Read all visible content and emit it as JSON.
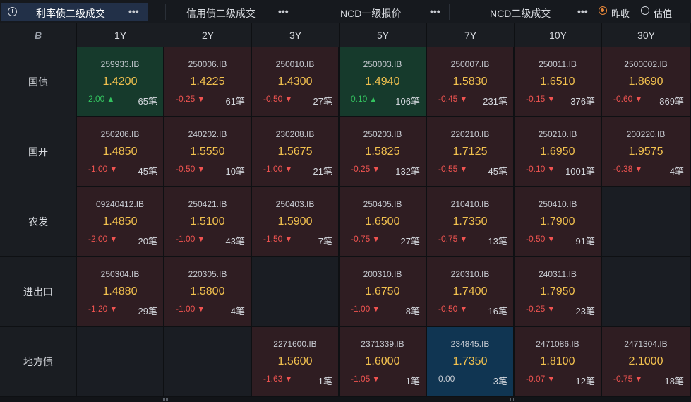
{
  "tabs": [
    {
      "label": "利率债二级成交",
      "more": "•••",
      "active": true
    },
    {
      "label": "信用债二级成交",
      "more": "•••",
      "active": false
    },
    {
      "label": "NCD一级报价",
      "more": "•••",
      "active": false
    },
    {
      "label": "NCD二级成交",
      "more": "•••",
      "active": false
    }
  ],
  "radios": [
    {
      "label": "昨收",
      "checked": true
    },
    {
      "label": "估值",
      "checked": false
    }
  ],
  "tenors": [
    "1Y",
    "2Y",
    "3Y",
    "5Y",
    "7Y",
    "10Y",
    "30Y"
  ],
  "corner_icon": "bloomberg-b-icon",
  "colors": {
    "down": "#ef5350",
    "up": "#33c25f",
    "yield": "#f2c14e",
    "active_tab": "#223048",
    "radio_checked": "#e7873a"
  },
  "rows": [
    {
      "name": "国债",
      "cells": [
        {
          "code": "259933.IB",
          "yield": "1.4200",
          "change": "2.00",
          "dir": "up",
          "count": "65笔"
        },
        {
          "code": "250006.IB",
          "yield": "1.4225",
          "change": "-0.25",
          "dir": "down",
          "count": "61笔"
        },
        {
          "code": "250010.IB",
          "yield": "1.4300",
          "change": "-0.50",
          "dir": "down",
          "count": "27笔"
        },
        {
          "code": "250003.IB",
          "yield": "1.4940",
          "change": "0.10",
          "dir": "up",
          "count": "106笔"
        },
        {
          "code": "250007.IB",
          "yield": "1.5830",
          "change": "-0.45",
          "dir": "down",
          "count": "231笔"
        },
        {
          "code": "250011.IB",
          "yield": "1.6510",
          "change": "-0.15",
          "dir": "down",
          "count": "376笔"
        },
        {
          "code": "2500002.IB",
          "yield": "1.8690",
          "change": "-0.60",
          "dir": "down",
          "count": "869笔"
        }
      ]
    },
    {
      "name": "国开",
      "cells": [
        {
          "code": "250206.IB",
          "yield": "1.4850",
          "change": "-1.00",
          "dir": "down",
          "count": "45笔"
        },
        {
          "code": "240202.IB",
          "yield": "1.5550",
          "change": "-0.50",
          "dir": "down",
          "count": "10笔"
        },
        {
          "code": "230208.IB",
          "yield": "1.5675",
          "change": "-1.00",
          "dir": "down",
          "count": "21笔"
        },
        {
          "code": "250203.IB",
          "yield": "1.5825",
          "change": "-0.25",
          "dir": "down",
          "count": "132笔"
        },
        {
          "code": "220210.IB",
          "yield": "1.7125",
          "change": "-0.55",
          "dir": "down",
          "count": "45笔"
        },
        {
          "code": "250210.IB",
          "yield": "1.6950",
          "change": "-0.10",
          "dir": "down",
          "count": "1001笔"
        },
        {
          "code": "200220.IB",
          "yield": "1.9575",
          "change": "-0.38",
          "dir": "down",
          "count": "4笔"
        }
      ]
    },
    {
      "name": "农发",
      "cells": [
        {
          "code": "09240412.IB",
          "yield": "1.4850",
          "change": "-2.00",
          "dir": "down",
          "count": "20笔"
        },
        {
          "code": "250421.IB",
          "yield": "1.5100",
          "change": "-1.00",
          "dir": "down",
          "count": "43笔"
        },
        {
          "code": "250403.IB",
          "yield": "1.5900",
          "change": "-1.50",
          "dir": "down",
          "count": "7笔"
        },
        {
          "code": "250405.IB",
          "yield": "1.6500",
          "change": "-0.75",
          "dir": "down",
          "count": "27笔"
        },
        {
          "code": "210410.IB",
          "yield": "1.7350",
          "change": "-0.75",
          "dir": "down",
          "count": "13笔"
        },
        {
          "code": "250410.IB",
          "yield": "1.7900",
          "change": "-0.50",
          "dir": "down",
          "count": "91笔"
        },
        null
      ]
    },
    {
      "name": "进出口",
      "cells": [
        {
          "code": "250304.IB",
          "yield": "1.4880",
          "change": "-1.20",
          "dir": "down",
          "count": "29笔"
        },
        {
          "code": "220305.IB",
          "yield": "1.5800",
          "change": "-1.00",
          "dir": "down",
          "count": "4笔"
        },
        null,
        {
          "code": "200310.IB",
          "yield": "1.6750",
          "change": "-1.00",
          "dir": "down",
          "count": "8笔"
        },
        {
          "code": "220310.IB",
          "yield": "1.7400",
          "change": "-0.50",
          "dir": "down",
          "count": "16笔"
        },
        {
          "code": "240311.IB",
          "yield": "1.7950",
          "change": "-0.25",
          "dir": "down",
          "count": "23笔"
        },
        null
      ]
    },
    {
      "name": "地方债",
      "cells": [
        null,
        null,
        {
          "code": "2271600.IB",
          "yield": "1.5600",
          "change": "-1.63",
          "dir": "down",
          "count": "1笔"
        },
        {
          "code": "2371339.IB",
          "yield": "1.6000",
          "change": "-1.05",
          "dir": "down",
          "count": "1笔"
        },
        {
          "code": "234845.IB",
          "yield": "1.7350",
          "change": "0.00",
          "dir": "flat",
          "count": "3笔"
        },
        {
          "code": "2471086.IB",
          "yield": "1.8100",
          "change": "-0.07",
          "dir": "down",
          "count": "12笔"
        },
        {
          "code": "2471304.IB",
          "yield": "2.1000",
          "change": "-0.75",
          "dir": "down",
          "count": "18笔"
        }
      ]
    }
  ]
}
